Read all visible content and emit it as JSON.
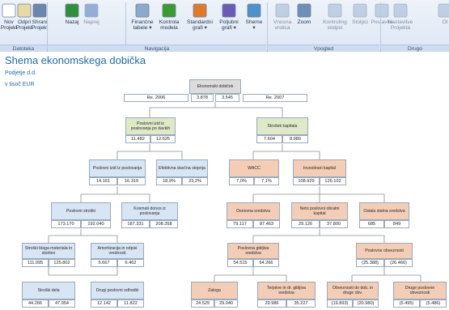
{
  "toolbar": {
    "buttons": [
      {
        "label": "Nov\nProjekt",
        "icon": "new-project-icon",
        "enabled": true
      },
      {
        "label": "Odpri\nProjekt",
        "icon": "open-project-icon",
        "enabled": true
      },
      {
        "label": "Shrani\nProjekt",
        "icon": "save-project-icon",
        "enabled": true
      },
      {
        "label": "Nazaj",
        "icon": "back-arrow-icon",
        "enabled": true
      },
      {
        "label": "Naprej",
        "icon": "forward-arrow-icon",
        "enabled": false
      },
      {
        "label": "Finančne\ntabele ▾",
        "icon": "financial-tables-icon",
        "enabled": true
      },
      {
        "label": "Kontrola\nmodela",
        "icon": "checkmark-icon",
        "enabled": true
      },
      {
        "label": "Standardni\ngrafi ▾",
        "icon": "bar-chart-icon",
        "enabled": true
      },
      {
        "label": "Poljubni\ngrafi ▾",
        "icon": "pie-chart-icon",
        "enabled": true
      },
      {
        "label": "Sheme\n▾",
        "icon": "scheme-icon",
        "enabled": true
      },
      {
        "label": "Vnosna\nvrstica",
        "icon": "input-row-icon",
        "enabled": false
      },
      {
        "label": "Zoom",
        "icon": "zoom-icon",
        "enabled": true
      },
      {
        "label": "Kontroling\nstolpci",
        "icon": "controlling-columns-icon",
        "enabled": false
      },
      {
        "label": "Stolpci",
        "icon": "columns-icon",
        "enabled": false
      },
      {
        "label": "Postavke",
        "icon": "items-icon",
        "enabled": false
      },
      {
        "label": "Nastavitve\nProjekta",
        "icon": "project-settings-icon",
        "enabled": false
      },
      {
        "label": "Ot",
        "icon": "other-icon",
        "enabled": false
      }
    ],
    "groups": [
      "Datoteka",
      "Navigacija",
      "Vpogled",
      "Drugo"
    ]
  },
  "page": {
    "title": "Shema ekonomskega dobička",
    "company": "Podjetje d.d.",
    "unit": "v tisoč EUR"
  },
  "header_row": {
    "year1": "Re. 2006",
    "v1": "3.878",
    "v2": "3.545",
    "year2": "Re. 2007"
  },
  "nodes": {
    "ekonomski": {
      "label": "Ekonomski dobiček"
    },
    "poslovni_izid": {
      "label": "Poslovni izid iz poslovanja po davkih",
      "v1": "11.482",
      "v2": "12.525"
    },
    "strosek_kapitala": {
      "label": "Strošek kapitala",
      "v1": "7.604",
      "v2": "8.980"
    },
    "pi_poslovanja": {
      "label": "Poslovni izid iz poslovanja",
      "v1": "14.161",
      "v2": "16.319"
    },
    "efektivna": {
      "label": "Efektivna davčna stopnja",
      "v1": "18,9%",
      "v2": "23,2%"
    },
    "wacc": {
      "label": "WACC",
      "v1": "7,0%",
      "v2": "7,1%"
    },
    "investirani": {
      "label": "Investirani kapital",
      "v1": "108.929",
      "v2": "126.102"
    },
    "poslovni_stroski": {
      "label": "Poslovni stroški",
      "v1": "173.170",
      "v2": "192.040"
    },
    "kosmati": {
      "label": "Kosmati donos iz poslovanja",
      "v1": "187.331",
      "v2": "208.358"
    },
    "osnovna": {
      "label": "Osnovna sredstva",
      "v1": "79.117",
      "v2": "87.463"
    },
    "neto_obratni": {
      "label": "Neto poslovni obratni kapital",
      "v1": "29.126",
      "v2": "37.800"
    },
    "ostala": {
      "label": "Ostala stalna sredstva",
      "v1": "685",
      "v2": "849"
    },
    "stroski_blaga": {
      "label": "Stroški blaga materiala in storitev",
      "v1": "111.095",
      "v2": "125.802"
    },
    "amortizacija": {
      "label": "Amortizacija in odpisi vrednosti",
      "v1": "5.667",
      "v2": "6.462"
    },
    "gibljiva": {
      "label": "Poslovna gibljiva sredstva",
      "v1": "54.515",
      "v2": "64.266"
    },
    "obveznosti": {
      "label": "Poslovne obveznosti",
      "v1": "(25.388)",
      "v2": "(26.466)"
    },
    "stroski_dela": {
      "label": "Stroški dela",
      "v1": "44.266",
      "v2": "47.954"
    },
    "drugi_odhodki": {
      "label": "Drugi poslovni odhodki",
      "v1": "12.142",
      "v2": "11.822"
    },
    "zaloga": {
      "label": "Zaloga",
      "v1": "24.529",
      "v2": "29.040"
    },
    "terjatve": {
      "label": "Terjatve in dr. gibljiva sredstva",
      "v1": "29.986",
      "v2": "35.227"
    },
    "obv_dob": {
      "label": "Obveznosti do dob. in drugе obv.",
      "v1": "(19.893)",
      "v2": "(20.980)"
    },
    "druge_obv": {
      "label": "Druge poslovne obveznosti",
      "v1": "(5.495)",
      "v2": "(5.486)"
    }
  }
}
